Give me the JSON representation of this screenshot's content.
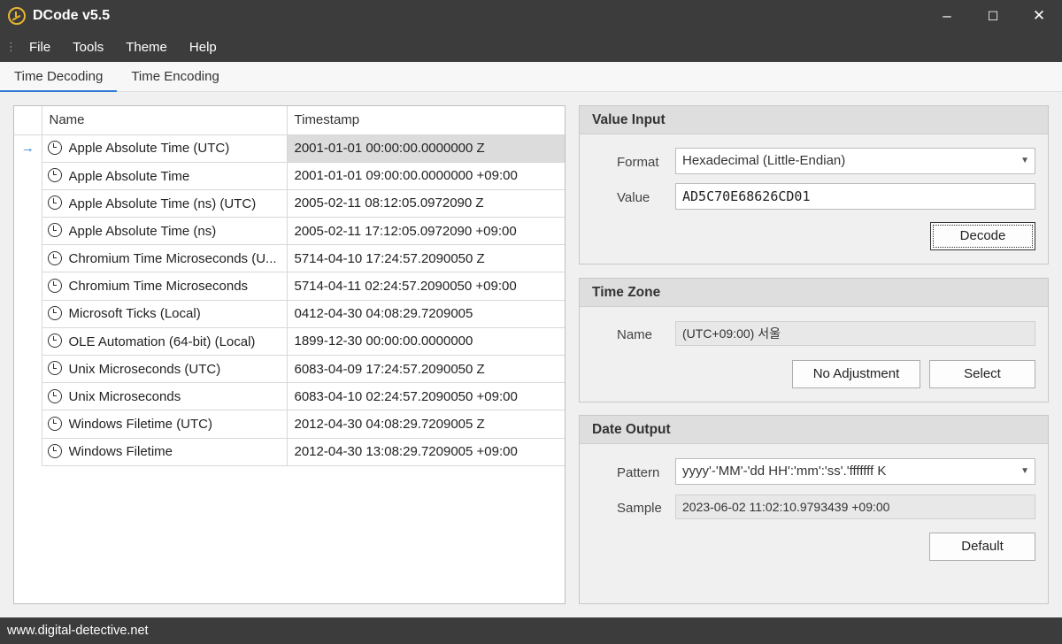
{
  "window": {
    "title": "DCode v5.5",
    "minimize": "–",
    "maximize": "☐",
    "close": "✕"
  },
  "menu": [
    "File",
    "Tools",
    "Theme",
    "Help"
  ],
  "tabs": [
    {
      "label": "Time Decoding",
      "active": true
    },
    {
      "label": "Time Encoding",
      "active": false
    }
  ],
  "table": {
    "columns": [
      "Name",
      "Timestamp"
    ],
    "selected_row": 0,
    "selected_indicator": "→",
    "rows": [
      {
        "name": "Apple Absolute Time (UTC)",
        "timestamp": "2001-01-01 00:00:00.0000000 Z"
      },
      {
        "name": "Apple Absolute Time",
        "timestamp": "2001-01-01 09:00:00.0000000 +09:00"
      },
      {
        "name": "Apple Absolute Time (ns) (UTC)",
        "timestamp": "2005-02-11 08:12:05.0972090 Z"
      },
      {
        "name": "Apple Absolute Time (ns)",
        "timestamp": "2005-02-11 17:12:05.0972090 +09:00"
      },
      {
        "name": "Chromium Time Microseconds (U...",
        "timestamp": "5714-04-10 17:24:57.2090050 Z"
      },
      {
        "name": "Chromium Time Microseconds",
        "timestamp": "5714-04-11 02:24:57.2090050 +09:00"
      },
      {
        "name": "Microsoft Ticks (Local)",
        "timestamp": "0412-04-30 04:08:29.7209005"
      },
      {
        "name": "OLE Automation (64-bit) (Local)",
        "timestamp": "1899-12-30 00:00:00.0000000"
      },
      {
        "name": "Unix Microseconds (UTC)",
        "timestamp": "6083-04-09 17:24:57.2090050 Z"
      },
      {
        "name": "Unix Microseconds",
        "timestamp": "6083-04-10 02:24:57.2090050 +09:00"
      },
      {
        "name": "Windows Filetime (UTC)",
        "timestamp": "2012-04-30 04:08:29.7209005 Z"
      },
      {
        "name": "Windows Filetime",
        "timestamp": "2012-04-30 13:08:29.7209005 +09:00"
      }
    ]
  },
  "value_input": {
    "header": "Value Input",
    "format_label": "Format",
    "format_value": "Hexadecimal (Little-Endian)",
    "value_label": "Value",
    "value": "AD5C70E68626CD01",
    "decode_button": "Decode"
  },
  "time_zone": {
    "header": "Time Zone",
    "name_label": "Name",
    "name_value": "(UTC+09:00) 서울",
    "no_adjustment_button": "No Adjustment",
    "select_button": "Select"
  },
  "date_output": {
    "header": "Date Output",
    "pattern_label": "Pattern",
    "pattern_value": "yyyy'-'MM'-'dd HH':'mm':'ss'.'fffffff K",
    "sample_label": "Sample",
    "sample_value": "2023-06-02 11:02:10.9793439 +09:00",
    "default_button": "Default"
  },
  "status": {
    "text": "www.digital-detective.net"
  },
  "colors": {
    "chrome": "#3c3c3c",
    "accent": "#2f7bd6",
    "panel_header": "#dedede",
    "selected_row": "#dcdcdc",
    "icon": "#e8b530"
  }
}
